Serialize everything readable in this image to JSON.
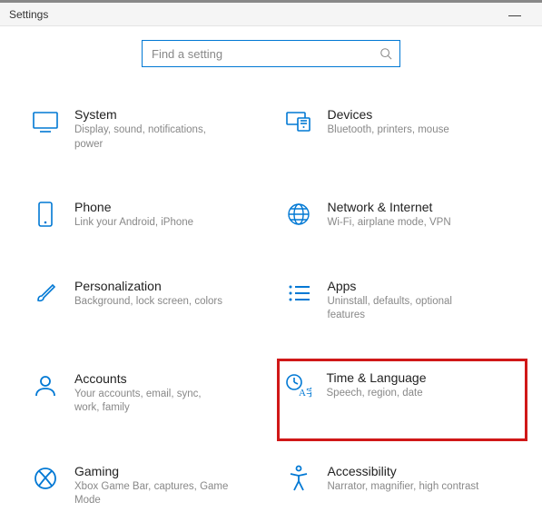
{
  "window": {
    "title": "Settings",
    "minimize_glyph": "—"
  },
  "search": {
    "placeholder": "Find a setting"
  },
  "tiles": {
    "system": {
      "title": "System",
      "desc": "Display, sound, notifications, power"
    },
    "devices": {
      "title": "Devices",
      "desc": "Bluetooth, printers, mouse"
    },
    "phone": {
      "title": "Phone",
      "desc": "Link your Android, iPhone"
    },
    "network": {
      "title": "Network & Internet",
      "desc": "Wi-Fi, airplane mode, VPN"
    },
    "personal": {
      "title": "Personalization",
      "desc": "Background, lock screen, colors"
    },
    "apps": {
      "title": "Apps",
      "desc": "Uninstall, defaults, optional features"
    },
    "accounts": {
      "title": "Accounts",
      "desc": "Your accounts, email, sync, work, family"
    },
    "time": {
      "title": "Time & Language",
      "desc": "Speech, region, date"
    },
    "gaming": {
      "title": "Gaming",
      "desc": "Xbox Game Bar, captures, Game Mode"
    },
    "access": {
      "title": "Accessibility",
      "desc": "Narrator, magnifier, high contrast"
    }
  }
}
